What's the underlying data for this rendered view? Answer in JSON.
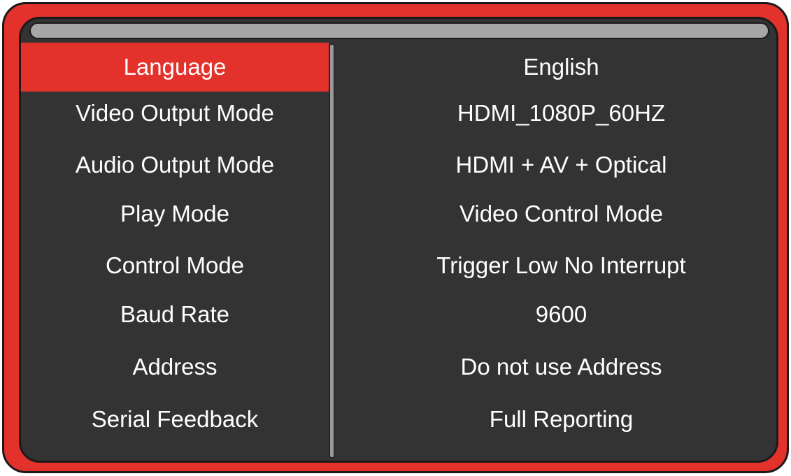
{
  "settings_menu": {
    "selected_index": 0,
    "items": [
      {
        "label": "Language",
        "value": "English"
      },
      {
        "label": "Video Output Mode",
        "value": "HDMI_1080P_60HZ"
      },
      {
        "label": "Audio Output Mode",
        "value": "HDMI + AV + Optical"
      },
      {
        "label": "Play Mode",
        "value": "Video Control Mode"
      },
      {
        "label": "Control Mode",
        "value": "Trigger Low No Interrupt"
      },
      {
        "label": "Baud Rate",
        "value": "9600"
      },
      {
        "label": "Address",
        "value": "Do not use Address"
      },
      {
        "label": "Serial Feedback",
        "value": "Full Reporting"
      }
    ]
  },
  "colors": {
    "frame": "#e3312b",
    "screen_background": "#333333",
    "selection_highlight": "#e3312b",
    "title_bar": "#a6a6a6",
    "text": "#ffffff"
  }
}
